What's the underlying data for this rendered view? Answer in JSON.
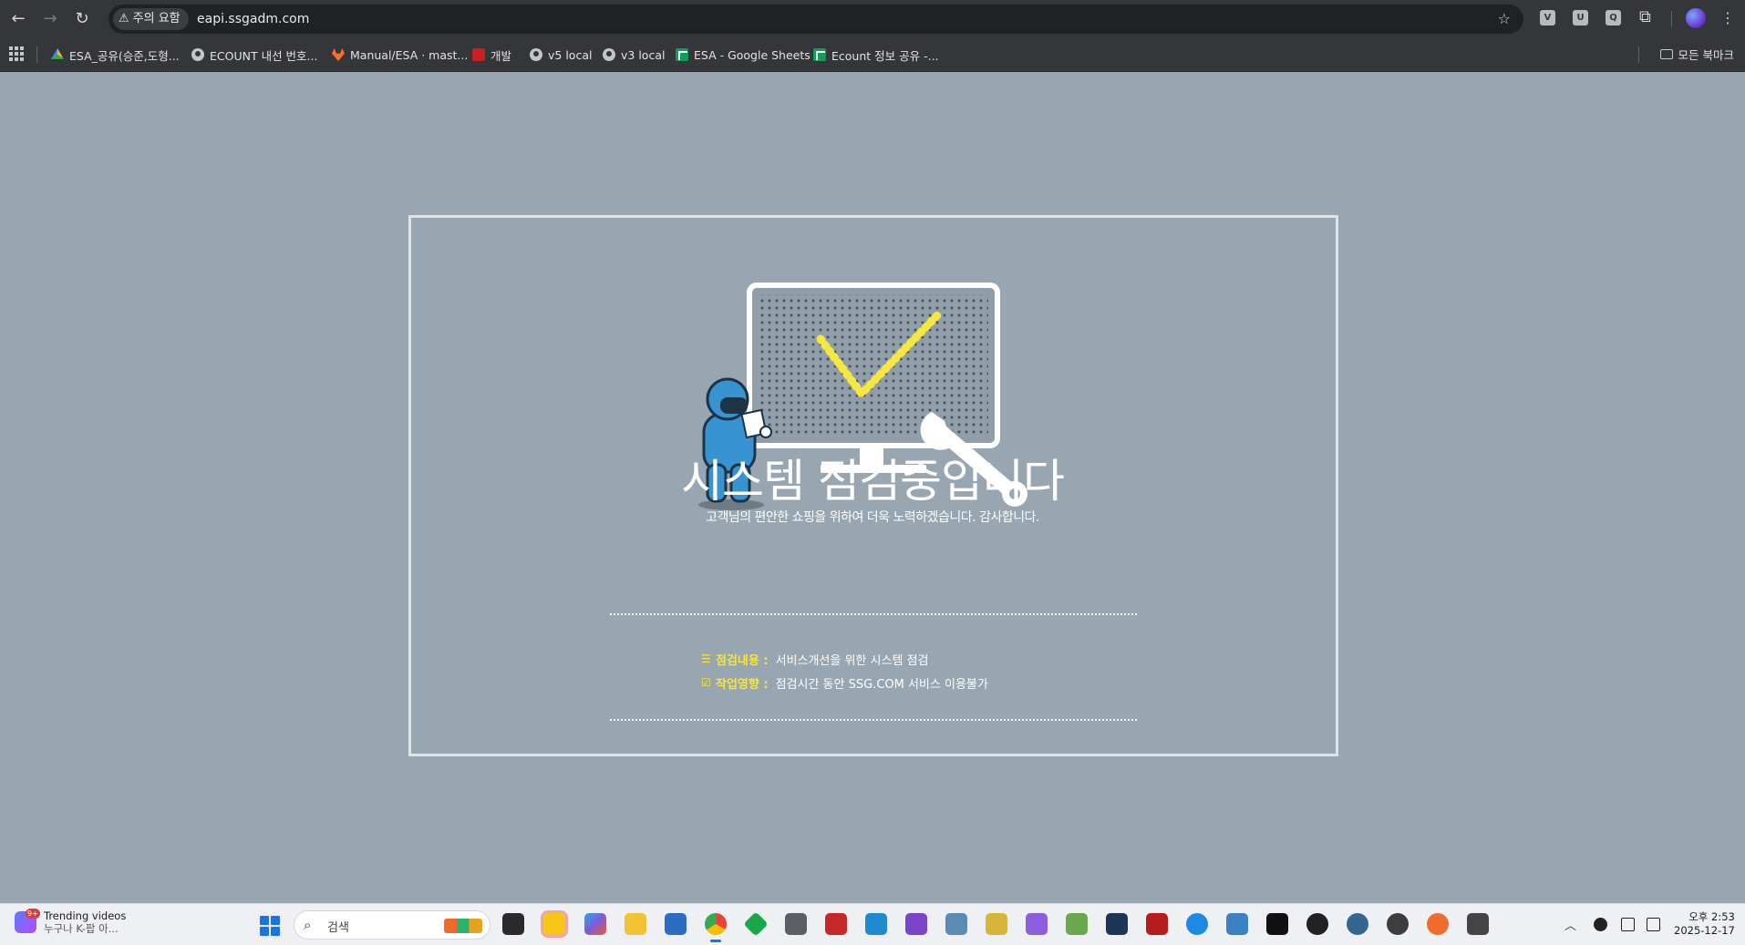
{
  "browser": {
    "security_chip": "주의 요함",
    "url": "eapi.ssgadm.com",
    "extensions": [
      "V",
      "U",
      "Q"
    ],
    "bookmarks": [
      {
        "label": "ESA_공유(승준,도형...",
        "icon": "google-drive-icon"
      },
      {
        "label": "ECOUNT 내선 번호...",
        "icon": "globe-icon"
      },
      {
        "label": "Manual/ESA · mast...",
        "icon": "gitlab-icon"
      },
      {
        "label": "개발",
        "icon": "red-doc-icon"
      },
      {
        "label": "v5 local",
        "icon": "globe-icon"
      },
      {
        "label": "v3 local",
        "icon": "globe-icon"
      },
      {
        "label": "ESA - Google Sheets",
        "icon": "google-sheets-icon"
      },
      {
        "label": "Ecount 정보 공유 -...",
        "icon": "google-sheets-icon"
      }
    ],
    "all_bookmarks": "모든 북마크"
  },
  "page": {
    "title": "시스템 점검중입니다",
    "subtitle": "고객님의 편안한 쇼핑을 위하여 더욱 노력하겠습니다. 감사합니다.",
    "info": [
      {
        "label": "점검내용 :",
        "value": "서비스개선을 위한 시스템 점검",
        "icon": "list-icon"
      },
      {
        "label": "작업영향 :",
        "value": "점검시간 동안 SSG.COM 서비스 이용불가",
        "icon": "checkbox-icon"
      }
    ],
    "colors": {
      "background": "#97a6b0",
      "accent": "#f5e642"
    }
  },
  "taskbar": {
    "widget_title": "Trending videos",
    "widget_sub": "누구나 K-팝 아...",
    "widget_badge": "9+",
    "search_placeholder": "검색",
    "clock_time": "오후 2:53",
    "clock_date": "2025-12-17"
  }
}
